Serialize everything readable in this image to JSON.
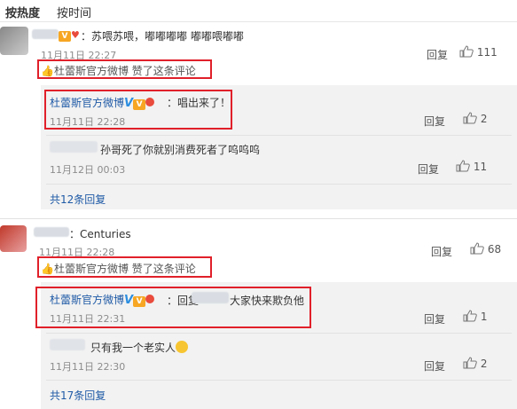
{
  "tabs": {
    "hot": "按热度",
    "time": "按时间"
  },
  "comments": [
    {
      "text": "：苏喂苏喂，嘟嘟嘟嘟 嘟嘟喂嘟嘟",
      "time": "11月11日 22:27",
      "liked_by": "杜蕾斯官方微博 赞了这条评论",
      "reply_label": "回复",
      "likes": "111",
      "replies": [
        {
          "author": "杜蕾斯官方微博",
          "text": "：唱出来了！",
          "time": "11月11日 22:28",
          "reply_label": "回复",
          "likes": "2"
        },
        {
          "author": "",
          "text": "孙哥死了你就别消费死者了呜呜呜",
          "time": "11月12日 00:03",
          "reply_label": "回复",
          "likes": "11"
        }
      ],
      "more": "共12条回复"
    },
    {
      "text": "：Centuries",
      "time": "11月11日 22:28",
      "liked_by": "杜蕾斯官方微博 赞了这条评论",
      "reply_label": "回复",
      "likes": "68",
      "replies": [
        {
          "author": "杜蕾斯官方微博",
          "text_prefix": "：回复",
          "text": "大家快来欺负他",
          "time": "11月11日 22:31",
          "reply_label": "回复",
          "likes": "1"
        },
        {
          "author": "",
          "text": "只有我一个老实人",
          "time": "11月11日 22:30",
          "reply_label": "回复",
          "likes": "2"
        }
      ],
      "more": "共17条回复"
    }
  ],
  "colors": {
    "highlight_box": "#e0202a",
    "link_blue": "#1f5aa6",
    "reply_bg": "#f2f2f2"
  }
}
